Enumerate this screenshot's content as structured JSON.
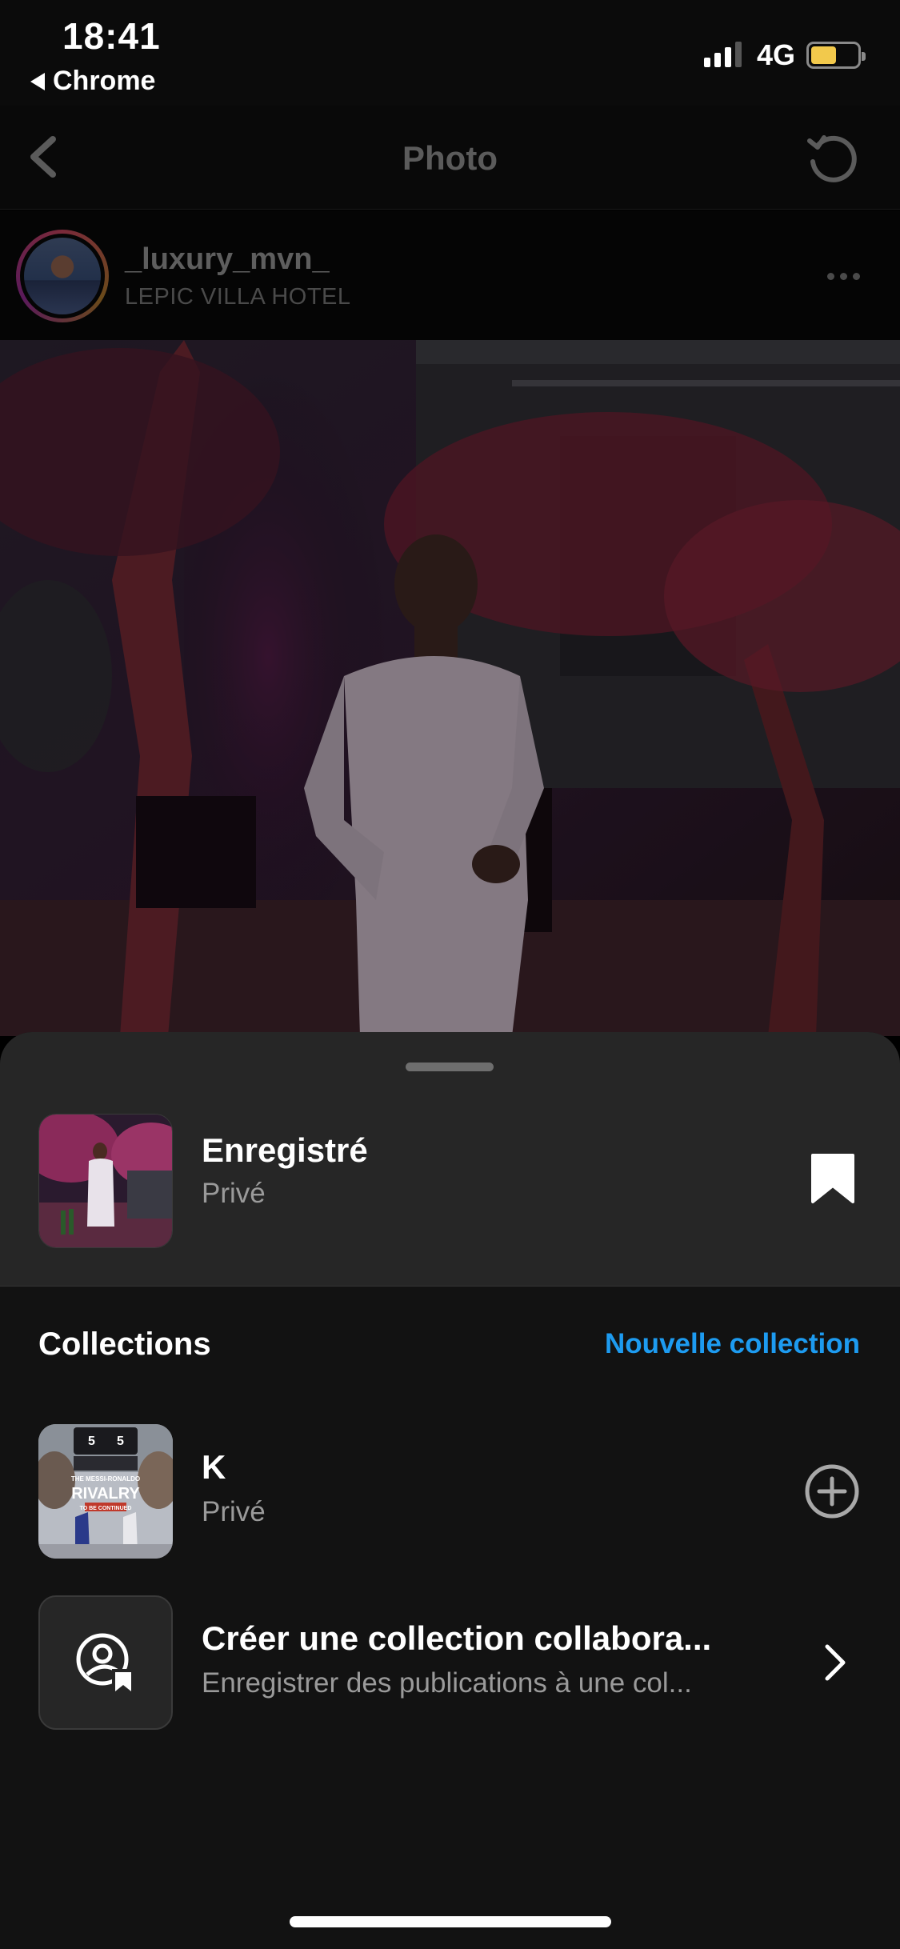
{
  "status_bar": {
    "time": "18:41",
    "back_app": "Chrome",
    "network": "4G",
    "battery_level": 0.55,
    "battery_color": "#f2c94c"
  },
  "nav": {
    "title": "Photo",
    "back_icon": "chevron-left-icon",
    "refresh_icon": "refresh-icon"
  },
  "post": {
    "username": "_luxury_mvn_",
    "location": "LEPIC VILLA HOTEL",
    "more_icon": "more-horizontal-icon"
  },
  "sheet": {
    "saved": {
      "title": "Enregistré",
      "subtitle": "Privé",
      "icon": "bookmark-filled-icon"
    },
    "collections_header": "Collections",
    "new_collection_label": "Nouvelle collection",
    "accent_color": "#1d9bf0",
    "collections": [
      {
        "title": "K",
        "subtitle": "Privé",
        "thumb_text": {
          "score_left": "5",
          "score_right": "5",
          "line1": "THE MESSI-RONALDO",
          "line2": "RIVALRY",
          "line3": "TO BE CONTINUED"
        },
        "action_icon": "add-circle-icon"
      },
      {
        "title": "Créer une collection collabora...",
        "subtitle": "Enregistrer des publications à une col...",
        "thumb_icon": "collaborative-collection-icon",
        "action_icon": "chevron-right-icon"
      }
    ]
  }
}
